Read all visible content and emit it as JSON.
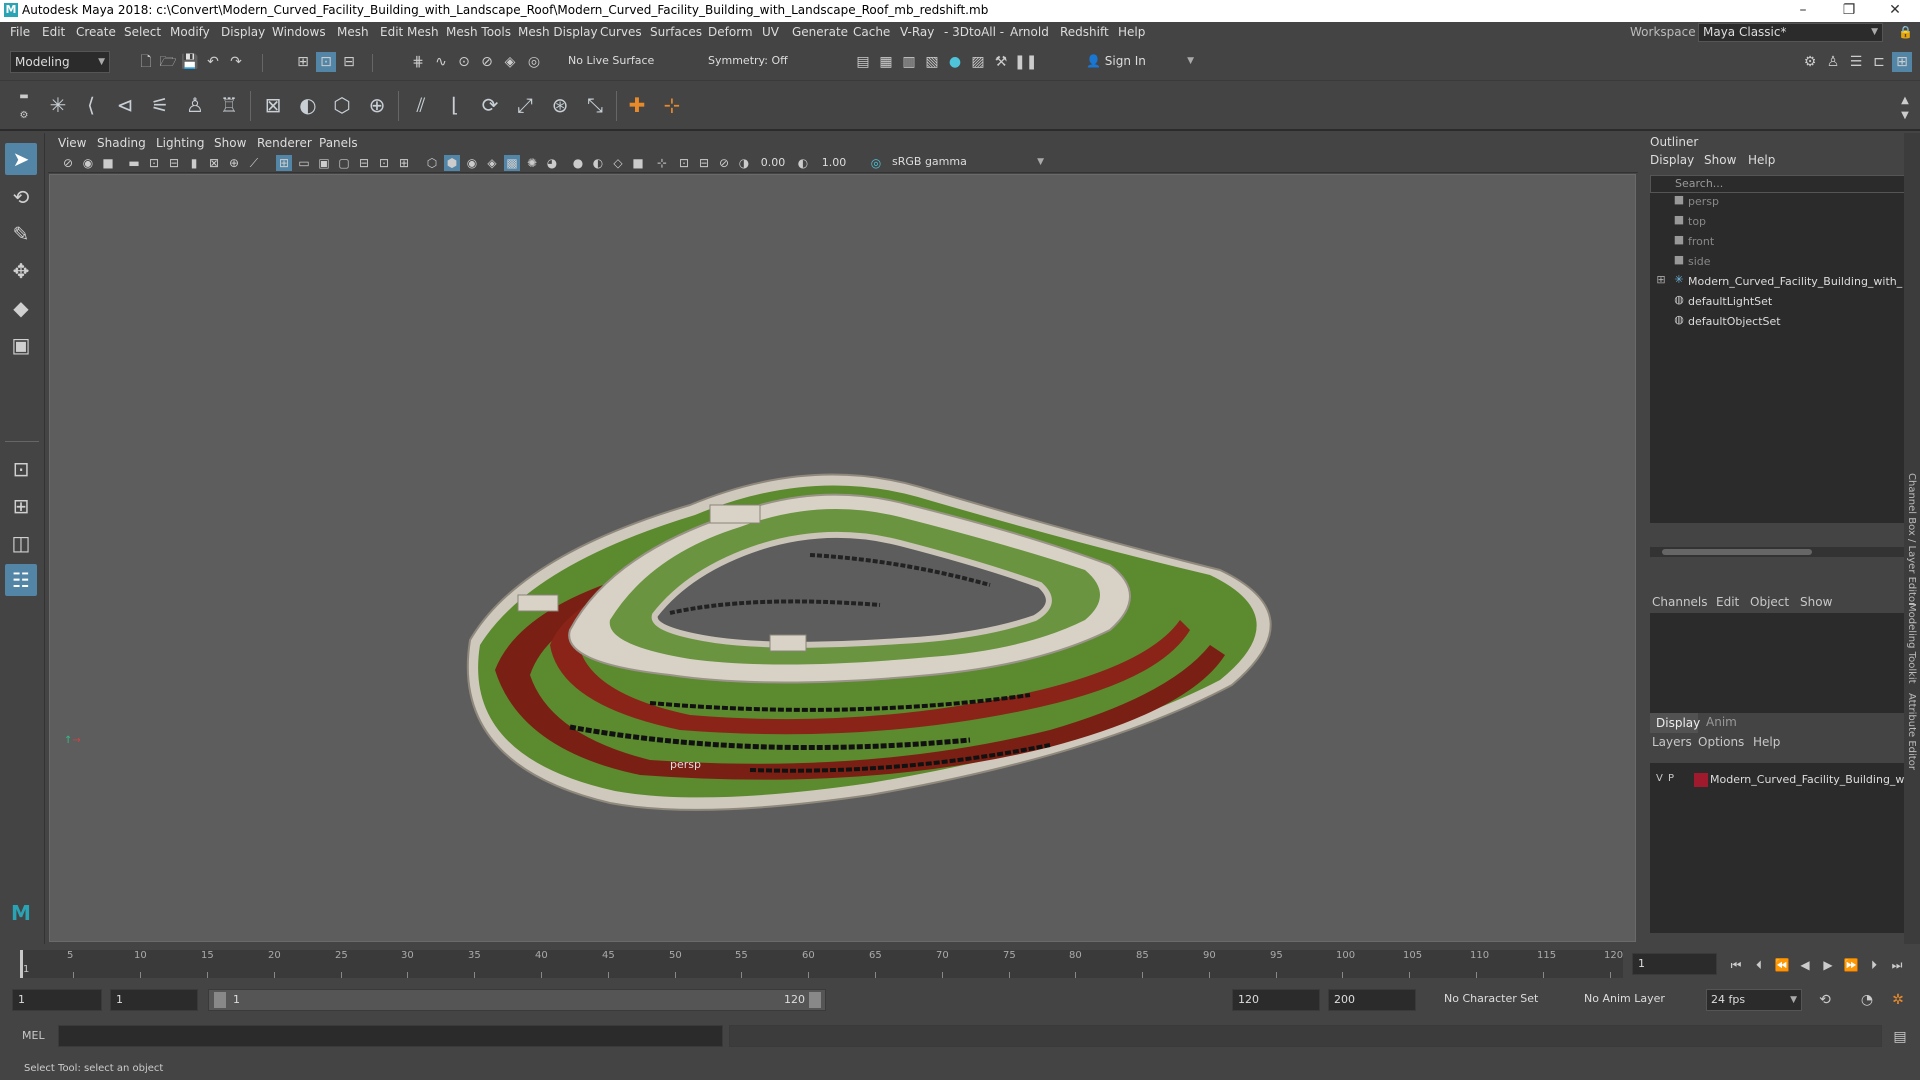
{
  "title_bar": {
    "title": "Autodesk Maya 2018: c:\\Convert\\Modern_Curved_Facility_Building_with_Landscape_Roof\\Modern_Curved_Facility_Building_with_Landscape_Roof_mb_redshift.mb",
    "minimize": "–",
    "maximize": "❐",
    "close": "✕"
  },
  "menu": {
    "items": [
      "File",
      "Edit",
      "Create",
      "Select",
      "Modify",
      "Display",
      "Windows",
      "Mesh",
      "Edit Mesh",
      "Mesh Tools",
      "Mesh Display",
      "Curves",
      "Surfaces",
      "Deform",
      "UV",
      "Generate",
      "Cache",
      "V-Ray",
      "- 3DtoAll -",
      "Arnold",
      "Redshift",
      "Help"
    ],
    "workspace_label": "Workspace :",
    "workspace_value": "Maya Classic*"
  },
  "status_toolbar": {
    "mode": "Modeling",
    "live_surface": "No Live Surface",
    "symmetry": "Symmetry: Off",
    "sign_in": "Sign In"
  },
  "panel_menu": {
    "items": [
      "View",
      "Shading",
      "Lighting",
      "Show",
      "Renderer",
      "Panels"
    ],
    "exposure": "0.00",
    "gamma": "1.00",
    "color_space": "sRGB gamma"
  },
  "viewport": {
    "camera_label": "persp"
  },
  "outliner": {
    "title": "Outliner",
    "menu": [
      "Display",
      "Show",
      "Help"
    ],
    "search_placeholder": "Search...",
    "items": [
      {
        "label": "persp",
        "icon": "camera-icon",
        "dim": true
      },
      {
        "label": "top",
        "icon": "camera-icon",
        "dim": true
      },
      {
        "label": "front",
        "icon": "camera-icon",
        "dim": true
      },
      {
        "label": "side",
        "icon": "camera-icon",
        "dim": true
      },
      {
        "label": "Modern_Curved_Facility_Building_with_",
        "icon": "group-icon",
        "dim": false,
        "expand": "⊞"
      },
      {
        "label": "defaultLightSet",
        "icon": "set-icon",
        "dim": false
      },
      {
        "label": "defaultObjectSet",
        "icon": "set-icon",
        "dim": false
      }
    ]
  },
  "channel_box": {
    "menu": [
      "Channels",
      "Edit",
      "Object",
      "Show"
    ]
  },
  "layer_editor": {
    "tabs": [
      "Display",
      "Anim"
    ],
    "menu": [
      "Layers",
      "Options",
      "Help"
    ],
    "layer": {
      "v": "V",
      "p": "P",
      "name": "Modern_Curved_Facility_Building_wi",
      "color": "#9e1a2c"
    }
  },
  "side_tabs": [
    "Channel Box / Layer Editor",
    "Modeling Toolkit",
    "Attribute Editor"
  ],
  "timeline": {
    "ticks": [
      "5",
      "10",
      "15",
      "20",
      "25",
      "30",
      "35",
      "40",
      "45",
      "50",
      "55",
      "60",
      "65",
      "70",
      "75",
      "80",
      "85",
      "90",
      "95",
      "100",
      "105",
      "110",
      "115",
      "120"
    ],
    "current_frame_marker": "1",
    "current_frame_field": "1"
  },
  "range": {
    "start": "1",
    "anim_start": "1",
    "slider_start": "1",
    "slider_end": "120",
    "end": "120",
    "anim_end": "200",
    "character_set": "No Character Set",
    "anim_layer": "No Anim Layer",
    "fps": "24 fps"
  },
  "command_line": {
    "label": "MEL"
  },
  "status_line": {
    "help": "Select Tool: select an object"
  },
  "colors": {
    "accent": "#5285a6",
    "roof_green": "#5c8a2e",
    "band_red": "#7a1f14"
  }
}
